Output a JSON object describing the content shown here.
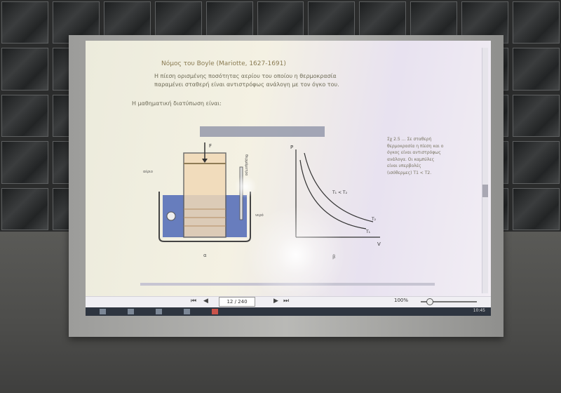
{
  "scene": {
    "description_text": "",
    "wall": "glass-block",
    "colors": {
      "wall_dark": "#2b2c2c",
      "screen": "#f2efe4",
      "frame": "#a9a9a6",
      "liquid": "#5a72b8",
      "taskbar": "#2e3540"
    }
  },
  "document": {
    "title": "Νόμος του Boyle (Mariotte, 1627-1691)",
    "paragraph": "Η πίεση ορισμένης ποσότητας αερίου του οποίου η θερμοκρασία παραμένει σταθερή είναι αντιστρόφως ανάλογη με τον όγκο του.",
    "line": "Η μαθηματική διατύπωση είναι:",
    "side_caption": "Σχ 2.5 … Σε σταθερή θερμοκρασία η πίεση και ο όγκος είναι αντιστρόφως ανάλογα. Οι καμπύλες είναι υπερβολές (ισόθερμες) Τ1 < Τ2.",
    "figure": {
      "left_labels": {
        "force": "F",
        "thermometer": "θερμόμετρο",
        "gas": "αέριο",
        "water": "νερό",
        "caption": "α"
      },
      "graph_labels": {
        "y_axis": "P",
        "x_axis": "V",
        "curve_1": "T₁",
        "curve_2": "T₂",
        "note": "T₁ < T₂",
        "caption": "β"
      }
    }
  },
  "pdf_viewer": {
    "page_indicator": "12 / 240",
    "zoom": "100%",
    "icons": [
      "first-page-icon",
      "prev-page-icon",
      "next-page-icon",
      "last-page-icon"
    ]
  },
  "taskbar": {
    "clock": "10:45",
    "icons": [
      "start-icon",
      "search-icon",
      "folder-icon",
      "browser-icon",
      "pdf-icon"
    ]
  }
}
